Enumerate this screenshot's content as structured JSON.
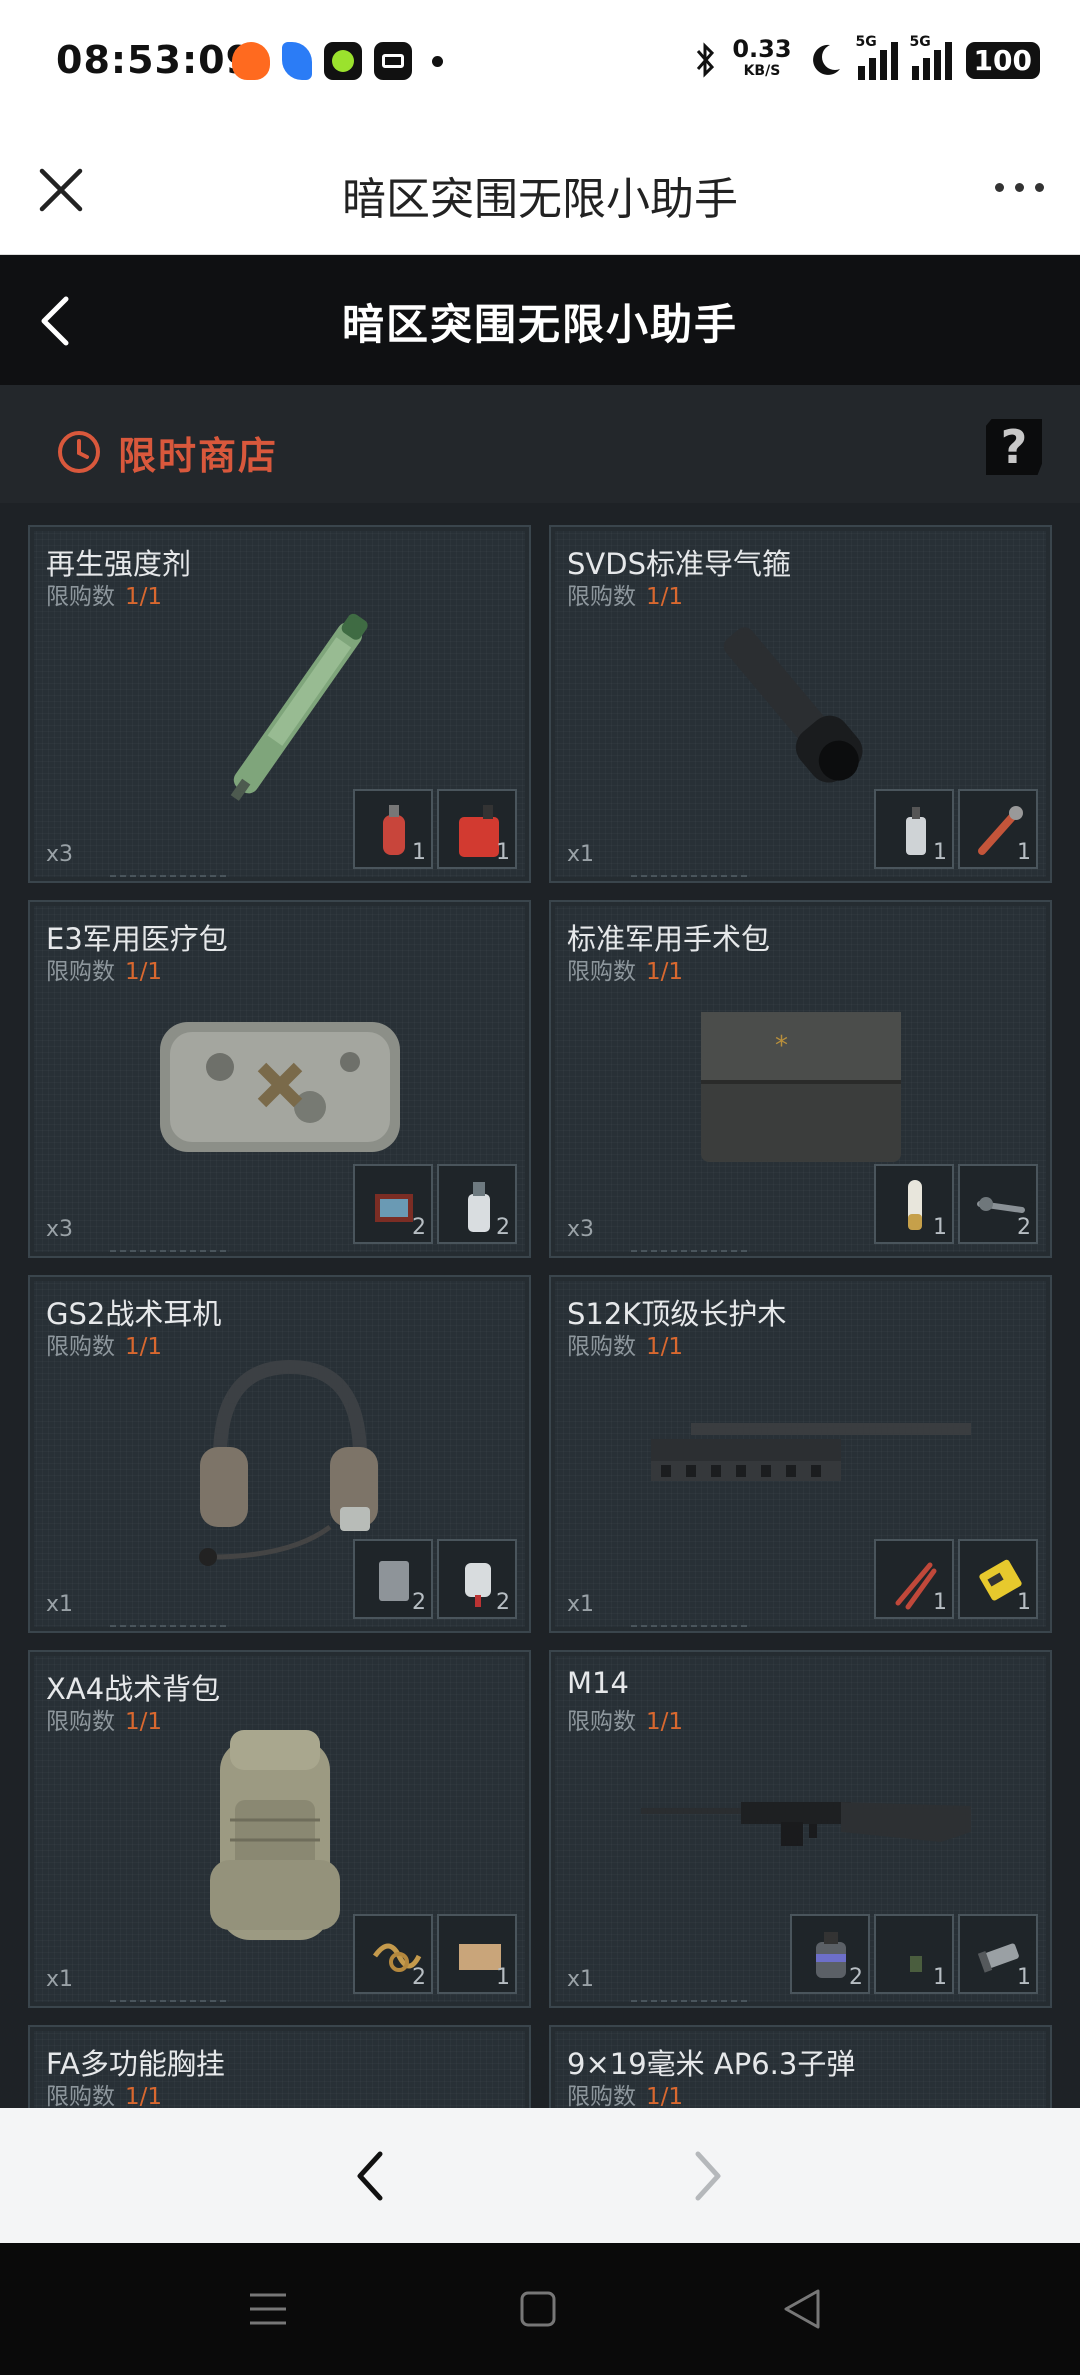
{
  "status_bar": {
    "time": "08:53:09",
    "net_speed": "0.33",
    "net_unit": "KB/S",
    "signal1_label": "5G",
    "signal2_label": "5G",
    "battery": "100"
  },
  "titlebar": {
    "title": "暗区突围无限小助手"
  },
  "app_header": {
    "title": "暗区突围无限小助手"
  },
  "shop": {
    "title": "限时商店",
    "help": "?",
    "accent_color": "#d9583c"
  },
  "limit_label": "限购数",
  "items": [
    {
      "name": "再生强度剂",
      "limit": "1/1",
      "qty": "x3",
      "slots": [
        "1",
        "1"
      ]
    },
    {
      "name": "SVDS标准导气箍",
      "limit": "1/1",
      "qty": "x1",
      "slots": [
        "1",
        "1"
      ]
    },
    {
      "name": "E3军用医疗包",
      "limit": "1/1",
      "qty": "x3",
      "slots": [
        "2",
        "2"
      ]
    },
    {
      "name": "标准军用手术包",
      "limit": "1/1",
      "qty": "x3",
      "slots": [
        "1",
        "2"
      ]
    },
    {
      "name": "GS2战术耳机",
      "limit": "1/1",
      "qty": "x1",
      "slots": [
        "2",
        "2"
      ]
    },
    {
      "name": "S12K顶级长护木",
      "limit": "1/1",
      "qty": "x1",
      "slots": [
        "1",
        "1"
      ]
    },
    {
      "name": "XA4战术背包",
      "limit": "1/1",
      "qty": "x1",
      "slots": [
        "2",
        "1"
      ]
    },
    {
      "name": "M14",
      "limit": "1/1",
      "qty": "x1",
      "slots": [
        "2",
        "1",
        "1"
      ]
    },
    {
      "name": "FA多功能胸挂",
      "limit": "1/1"
    },
    {
      "name": "9×19毫米 AP6.3子弹",
      "limit": "1/1"
    }
  ]
}
